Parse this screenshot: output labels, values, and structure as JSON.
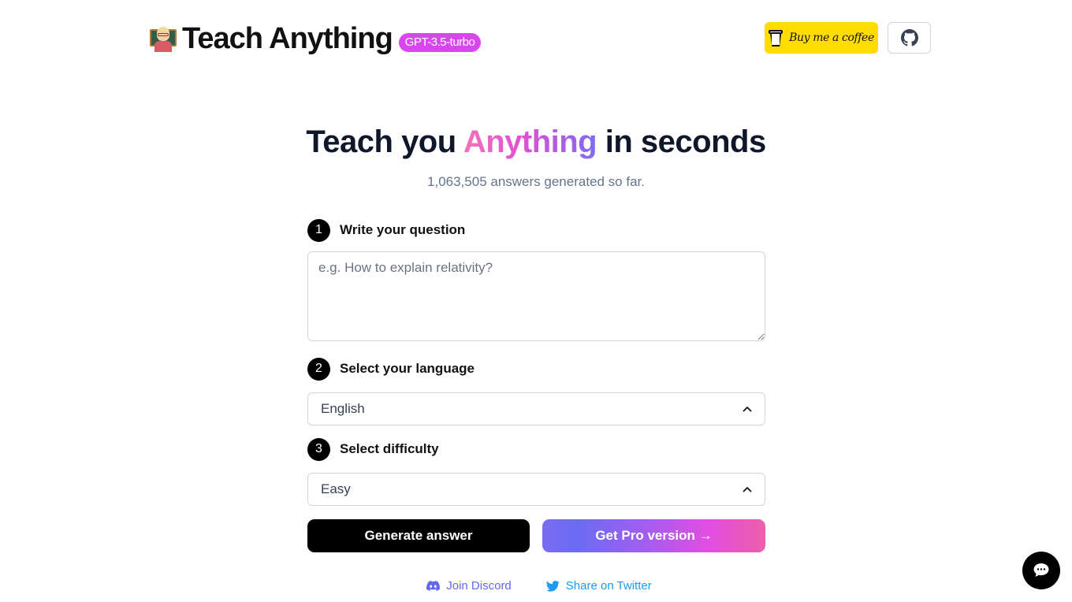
{
  "header": {
    "brand_title": "Teach Anything",
    "brand_icon": "teacher-emoji-icon",
    "model_badge": "GPT-3.5-turbo",
    "coffee_label": "Buy me a coffee",
    "coffee_icon": "coffee-cup-icon",
    "github_icon": "github-icon"
  },
  "hero": {
    "title_before": "Teach you ",
    "title_accent": "Anything",
    "title_after": " in seconds",
    "subtitle": "1,063,505 answers generated so far."
  },
  "form": {
    "steps": [
      {
        "number": "1",
        "label": "Write your question"
      },
      {
        "number": "2",
        "label": "Select your language"
      },
      {
        "number": "3",
        "label": "Select difficulty"
      }
    ],
    "question_placeholder": "e.g. How to explain relativity?",
    "question_value": "",
    "language_selected": "English",
    "difficulty_selected": "Easy"
  },
  "actions": {
    "generate_label": "Generate answer",
    "pro_label": "Get Pro version →"
  },
  "social": {
    "discord_label": "Join Discord",
    "twitter_label": "Share on Twitter"
  },
  "colors": {
    "badge": "#d946ef",
    "coffee": "#ffdd00",
    "accent_start": "#f472b6",
    "accent_end": "#7c6cf0",
    "discord": "#6366f1",
    "twitter": "#1d9bf0"
  }
}
